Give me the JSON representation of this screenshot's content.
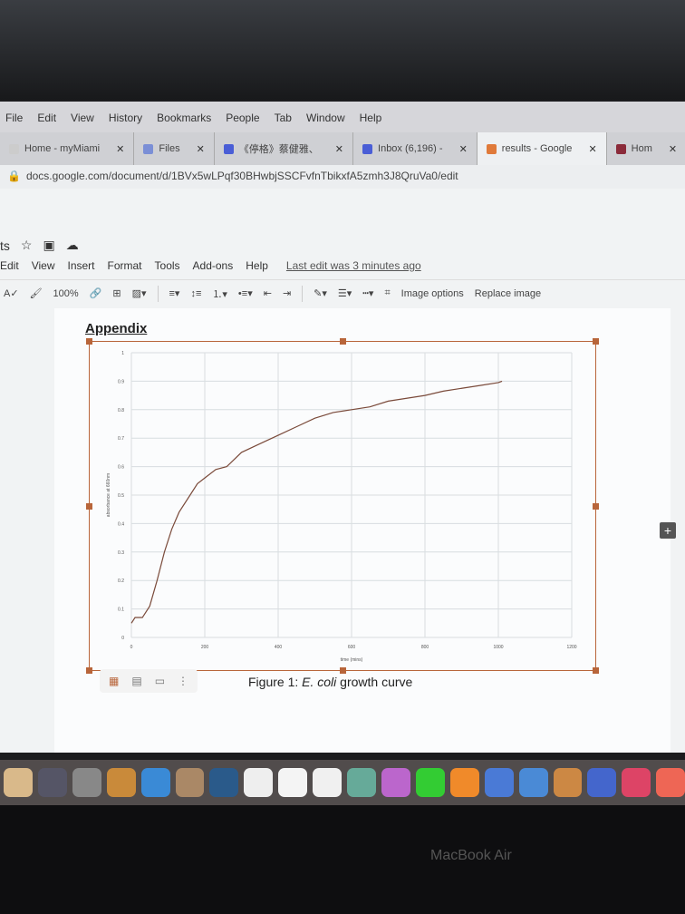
{
  "menubar": [
    "File",
    "Edit",
    "View",
    "History",
    "Bookmarks",
    "People",
    "Tab",
    "Window",
    "Help"
  ],
  "tabs": [
    {
      "label": "Home - myMiami",
      "color": "#ccc"
    },
    {
      "label": "Files",
      "color": "#7b8fd6"
    },
    {
      "label": "《停格》蔡健雅、",
      "color": "#4a5ed6"
    },
    {
      "label": "Inbox (6,196) -",
      "color": "#4a5ed6"
    },
    {
      "label": "results - Google",
      "color": "#e07a3a",
      "active": true
    },
    {
      "label": "Hom",
      "color": "#8b2b3a"
    }
  ],
  "url": "docs.google.com/document/d/1BVx5wLPqf30BHwbjSSCFvfnTbikxfA5zmh3J8QruVa0/edit",
  "doc": {
    "title": "ts",
    "menu": [
      "Edit",
      "View",
      "Insert",
      "Format",
      "Tools",
      "Add-ons",
      "Help"
    ],
    "last_edit": "Last edit was 3 minutes ago"
  },
  "toolbar": {
    "zoom": "100%",
    "image_options": "Image options",
    "replace_image": "Replace image"
  },
  "heading": "Appendix",
  "caption": {
    "prefix": "Figure 1: ",
    "italic": "E. coli",
    "suffix": " growth curve"
  },
  "device_label": "MacBook Air",
  "chart_data": {
    "type": "line",
    "title": "",
    "xlabel": "time (mins)",
    "ylabel": "absorbance at 660nm",
    "xlim": [
      0,
      1200
    ],
    "ylim": [
      0,
      1
    ],
    "xticks": [
      0,
      200,
      400,
      600,
      800,
      1000,
      1200
    ],
    "yticks": [
      0,
      0.1,
      0.2,
      0.3,
      0.4,
      0.5,
      0.6,
      0.7,
      0.8,
      0.9,
      1
    ],
    "grid": true,
    "line_color": "#7a4a3a",
    "x": [
      0,
      10,
      30,
      50,
      70,
      90,
      110,
      130,
      160,
      180,
      200,
      230,
      260,
      300,
      350,
      400,
      450,
      500,
      550,
      600,
      650,
      700,
      750,
      800,
      850,
      900,
      950,
      1000,
      1010
    ],
    "y": [
      0.05,
      0.07,
      0.07,
      0.11,
      0.2,
      0.3,
      0.38,
      0.44,
      0.5,
      0.54,
      0.56,
      0.59,
      0.6,
      0.65,
      0.68,
      0.71,
      0.74,
      0.77,
      0.79,
      0.8,
      0.81,
      0.83,
      0.84,
      0.85,
      0.865,
      0.875,
      0.885,
      0.895,
      0.9
    ]
  }
}
